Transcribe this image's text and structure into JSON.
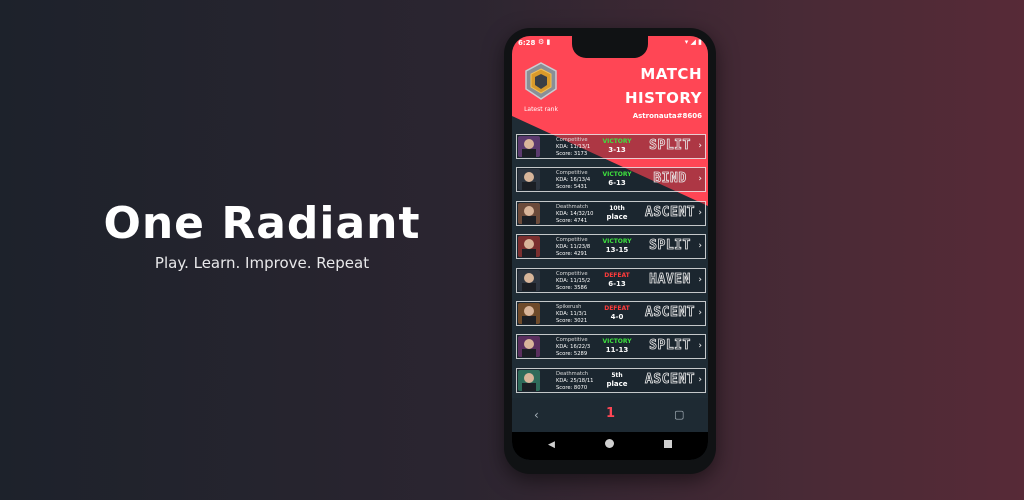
{
  "brand": {
    "title": "One Radiant",
    "tagline": "Play. Learn. Improve. Repeat"
  },
  "status_bar": {
    "time": "6:28",
    "left_icons": [
      "settings-icon",
      "sim-icon"
    ],
    "right_icons": [
      "wifi-icon",
      "signal-icon",
      "battery-icon"
    ]
  },
  "rank": {
    "label": "Latest rank"
  },
  "header": {
    "title_line1": "MATCH",
    "title_line2": "HISTORY",
    "username": "Astronauta#8606"
  },
  "colors": {
    "accent": "#ff4655",
    "victory": "#3ee03e",
    "defeat": "#ff3b3b",
    "dark_panel": "#1f2c35"
  },
  "matches": [
    {
      "mode": "Competitive",
      "kda": "KDA: 11/13/1",
      "score": "Score: 3173",
      "outcome": "VICTORY",
      "outcome_type": "victory",
      "result": "3-13",
      "map": "SPLIT"
    },
    {
      "mode": "Competitive",
      "kda": "KDA: 16/13/4",
      "score": "Score: 5431",
      "outcome": "VICTORY",
      "outcome_type": "victory",
      "result": "6-13",
      "map": "BIND"
    },
    {
      "mode": "Deathmatch",
      "kda": "KDA: 14/32/10",
      "score": "Score: 4741",
      "outcome": "10th",
      "outcome_type": "place",
      "result": "place",
      "map": "ASCENT"
    },
    {
      "mode": "Competitive",
      "kda": "KDA: 11/23/8",
      "score": "Score: 4291",
      "outcome": "VICTORY",
      "outcome_type": "victory",
      "result": "13-15",
      "map": "SPLIT"
    },
    {
      "mode": "Competitive",
      "kda": "KDA: 11/15/2",
      "score": "Score: 3586",
      "outcome": "DEFEAT",
      "outcome_type": "defeat",
      "result": "6-13",
      "map": "HAVEN"
    },
    {
      "mode": "Spikerush",
      "kda": "KDA: 11/3/1",
      "score": "Score: 3021",
      "outcome": "DEFEAT",
      "outcome_type": "defeat",
      "result": "4-0",
      "map": "ASCENT"
    },
    {
      "mode": "Competitive",
      "kda": "KDA: 16/22/3",
      "score": "Score: 5289",
      "outcome": "VICTORY",
      "outcome_type": "victory",
      "result": "11-13",
      "map": "SPLIT"
    },
    {
      "mode": "Deathmatch",
      "kda": "KDA: 25/18/11",
      "score": "Score: 8070",
      "outcome": "5th",
      "outcome_type": "place",
      "result": "place",
      "map": "ASCENT"
    }
  ],
  "bottom_nav": {
    "back_icon": "chevron-left-icon",
    "logo_icon": "app-logo-icon",
    "chat_icon": "chat-icon"
  }
}
